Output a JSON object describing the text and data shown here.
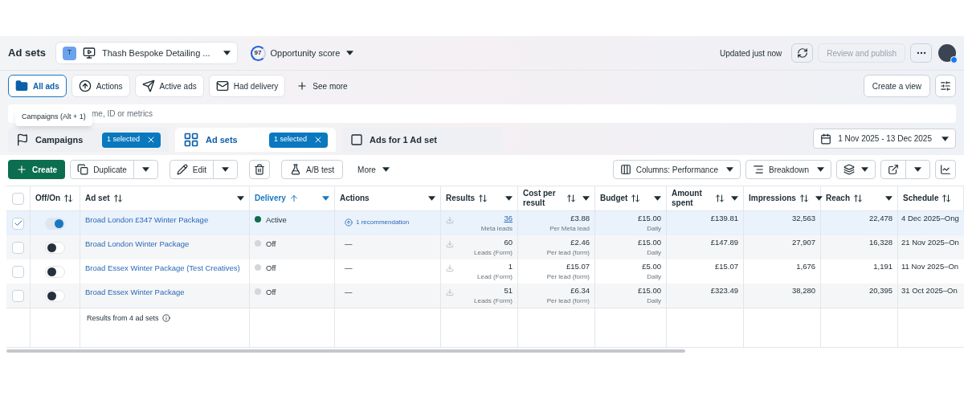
{
  "header": {
    "title": "Ad sets",
    "account_badge": "T",
    "account_name": "Thash Bespoke Detailing ...",
    "score": "97",
    "score_label": "Opportunity score",
    "updated": "Updated just now",
    "publish": "Review and publish",
    "publish_disabled": true
  },
  "filters": [
    {
      "label": "All ads",
      "selected": true,
      "kind": "folder"
    },
    {
      "label": "Actions",
      "selected": false,
      "kind": "actions"
    },
    {
      "label": "Active ads",
      "selected": false,
      "kind": "send"
    },
    {
      "label": "Had delivery",
      "selected": false,
      "kind": "mail"
    }
  ],
  "see_more": "See more",
  "create_view": "Create a view",
  "search": {
    "placeholder": "me, ID or metrics"
  },
  "tooltip": "Campaigns (Alt + 1)",
  "tabs": [
    {
      "label": "Campaigns",
      "selected": false,
      "badge": "1 selected",
      "kind": "campaigns"
    },
    {
      "label": "Ad sets",
      "selected": true,
      "badge": "1 selected",
      "kind": "adsets"
    },
    {
      "label": "Ads for 1 Ad set",
      "selected": false,
      "kind": "ads"
    }
  ],
  "date_range": "1 Nov 2025 - 13 Dec 2025",
  "toolbar": {
    "create": "Create",
    "duplicate": "Duplicate",
    "edit": "Edit",
    "ab_test": "A/B test",
    "more": "More",
    "columns": "Columns: Performance",
    "breakdown": "Breakdown"
  },
  "table": {
    "select_all_checked": false,
    "columns": [
      {
        "label": "Off/On",
        "sortable": true,
        "sorted": false
      },
      {
        "label": "Ad set",
        "sortable": true,
        "sorted": false
      },
      {
        "label": "Delivery",
        "sortable": true,
        "sorted": true
      },
      {
        "label": "Actions",
        "sortable": false,
        "sorted": false
      },
      {
        "label": "Results",
        "sortable": true,
        "sorted": false
      },
      {
        "label": "Cost per result",
        "sortable": true,
        "sorted": false
      },
      {
        "label": "Budget",
        "sortable": true,
        "sorted": false
      },
      {
        "label": "Amount spent",
        "sortable": true,
        "sorted": false
      },
      {
        "label": "Impressions",
        "sortable": true,
        "sorted": false
      },
      {
        "label": "Reach",
        "sortable": true,
        "sorted": false
      },
      {
        "label": "Schedule",
        "sortable": true,
        "sorted": false
      }
    ],
    "rows": [
      {
        "checked": true,
        "on": true,
        "name": "Broad London £347 Winter Package",
        "delivery": "Active",
        "delivery_active": true,
        "action": "1 recommendation",
        "results": "36",
        "results_link": true,
        "results_sub": "Meta leads",
        "cost": "£3.88",
        "cost_sub": "Per Meta lead",
        "budget": "£15.00",
        "budget_sub": "Daily",
        "spent": "£139.81",
        "impressions": "32,563",
        "reach": "22,478",
        "schedule": "4 Dec 2025–Ong"
      },
      {
        "checked": false,
        "on": false,
        "name": "Broad London Winter Package",
        "delivery": "Off",
        "delivery_active": false,
        "action": "—",
        "results": "60",
        "results_link": false,
        "results_sub": "Leads (Form)",
        "cost": "£2.46",
        "cost_sub": "Per lead (form)",
        "budget": "£15.00",
        "budget_sub": "Daily",
        "spent": "£147.89",
        "impressions": "27,907",
        "reach": "16,328",
        "schedule": "21 Nov 2025–On"
      },
      {
        "checked": false,
        "on": false,
        "name": "Broad Essex Winter Package (Test Creatives)",
        "delivery": "Off",
        "delivery_active": false,
        "action": "—",
        "results": "1",
        "results_link": false,
        "results_sub": "Lead (Form)",
        "cost": "£15.07",
        "cost_sub": "Per lead (form)",
        "budget": "£5.00",
        "budget_sub": "Daily",
        "spent": "£15.07",
        "impressions": "1,676",
        "reach": "1,191",
        "schedule": "11 Nov 2025–On"
      },
      {
        "checked": false,
        "on": false,
        "name": "Broad Essex Winter Package",
        "delivery": "Off",
        "delivery_active": false,
        "action": "—",
        "results": "51",
        "results_link": false,
        "results_sub": "Leads (Form)",
        "cost": "£6.34",
        "cost_sub": "Per lead (form)",
        "budget": "£15.00",
        "budget_sub": "Daily",
        "spent": "£323.49",
        "impressions": "38,280",
        "reach": "20,395",
        "schedule": "31 Oct 2025–On"
      }
    ],
    "footer": "Results from 4 ad sets"
  }
}
